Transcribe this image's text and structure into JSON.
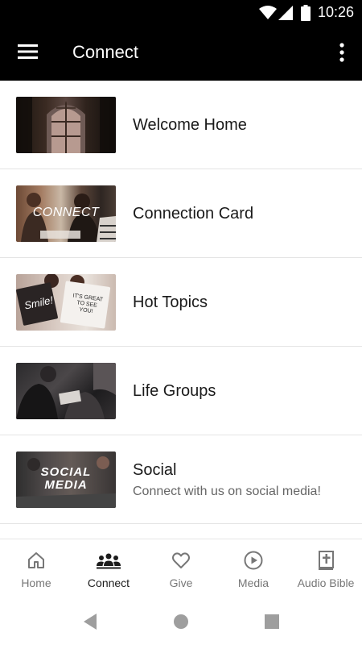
{
  "status_bar": {
    "time": "10:26"
  },
  "app_bar": {
    "title": "Connect"
  },
  "list": [
    {
      "title": "Welcome Home",
      "subtitle": ""
    },
    {
      "title": "Connection Card",
      "subtitle": "",
      "thumb_text": "CONNECT"
    },
    {
      "title": "Hot Topics",
      "subtitle": "",
      "thumb_text_1": "Smile!",
      "thumb_text_2": "IT'S GREAT TO SEE YOU!"
    },
    {
      "title": "Life Groups",
      "subtitle": ""
    },
    {
      "title": "Social",
      "subtitle": "Connect with us on social media!",
      "thumb_text": "SOCIAL MEDIA"
    }
  ],
  "bottom_nav": [
    {
      "label": "Home",
      "icon": "home-icon",
      "active": false
    },
    {
      "label": "Connect",
      "icon": "people-icon",
      "active": true
    },
    {
      "label": "Give",
      "icon": "heart-icon",
      "active": false
    },
    {
      "label": "Media",
      "icon": "play-circle-icon",
      "active": false
    },
    {
      "label": "Audio Bible",
      "icon": "bible-icon",
      "active": false
    }
  ],
  "colors": {
    "app_bar": "#000000",
    "active_nav": "#1c1c1c",
    "inactive_nav": "#777777"
  }
}
